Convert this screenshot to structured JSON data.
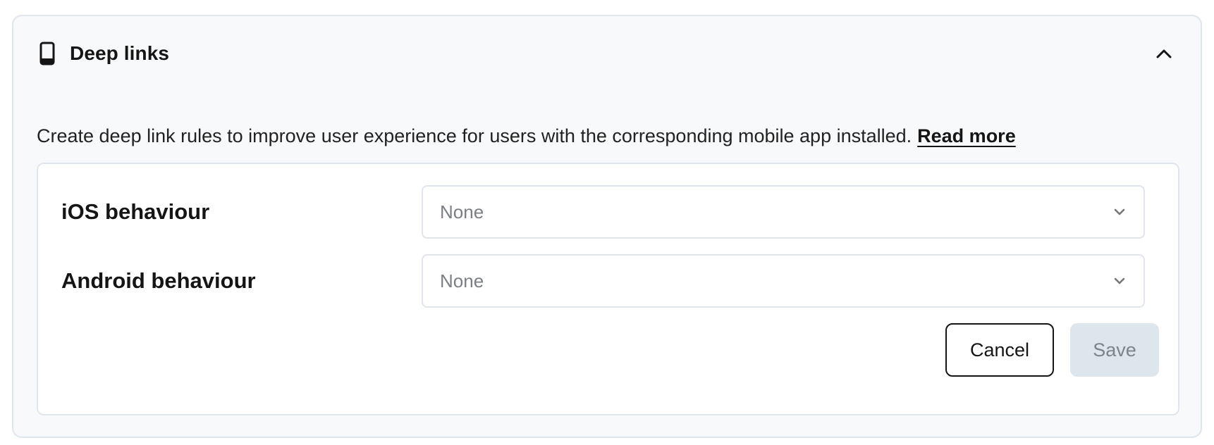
{
  "panel": {
    "icon": "mobile-phone-icon",
    "title": "Deep links",
    "collapse_icon": "chevron-up-icon"
  },
  "description": {
    "text": "Create deep link rules to improve user experience for users with the corresponding mobile app installed.",
    "link_label": "Read more"
  },
  "form": {
    "ios": {
      "label": "iOS behaviour",
      "value": "None",
      "icon": "chevron-down-icon"
    },
    "android": {
      "label": "Android behaviour",
      "value": "None",
      "icon": "chevron-down-icon"
    },
    "cancel_label": "Cancel",
    "save_label": "Save"
  },
  "colors": {
    "panel_bg": "#f8f9fb",
    "border": "#dfe6ee",
    "save_disabled_bg": "#dde6ec"
  }
}
